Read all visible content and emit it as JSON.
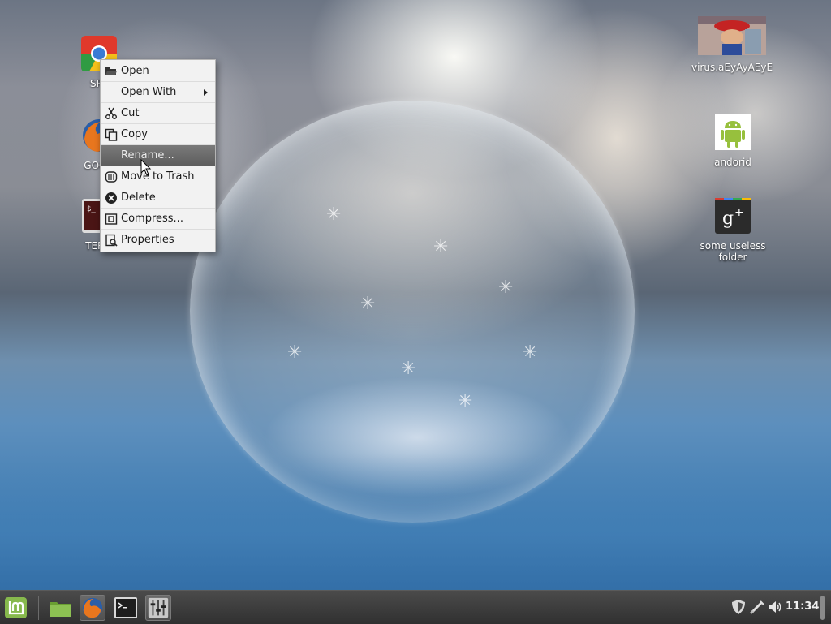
{
  "desktop": {
    "icons": [
      {
        "label": "SPY",
        "icon": "chrome-icon"
      },
      {
        "label": "GOOD",
        "icon": "firefox-icon"
      },
      {
        "label": "TERM",
        "icon": "terminal-icon"
      },
      {
        "label": "virus.aEyAyAEyE",
        "icon": "image-thumbnail-icon"
      },
      {
        "label": "andorid",
        "icon": "android-icon"
      },
      {
        "label": "some useless folder",
        "icon": "google-plus-icon"
      }
    ]
  },
  "context_menu": {
    "items": [
      {
        "label": "Open",
        "icon": "folder-open-icon",
        "highlighted": false
      },
      {
        "label": "Open With",
        "icon": "",
        "submenu": true,
        "highlighted": false
      },
      {
        "label": "Cut",
        "icon": "scissors-icon",
        "highlighted": false
      },
      {
        "label": "Copy",
        "icon": "copy-icon",
        "highlighted": false
      },
      {
        "label": "Rename...",
        "icon": "",
        "highlighted": true
      },
      {
        "label": "Move to Trash",
        "icon": "trash-icon",
        "highlighted": false
      },
      {
        "label": "Delete",
        "icon": "delete-icon",
        "highlighted": false
      },
      {
        "label": "Compress...",
        "icon": "compress-icon",
        "highlighted": false
      },
      {
        "label": "Properties",
        "icon": "properties-icon",
        "highlighted": false
      }
    ]
  },
  "panel": {
    "launchers": [
      "mint-menu-icon",
      "files-icon",
      "firefox-icon",
      "terminal-icon",
      "mixer-icon"
    ],
    "tray": [
      "shield-icon",
      "network-icon",
      "volume-icon"
    ],
    "clock": "11:34"
  },
  "colors": {
    "panel_bg": "#3a3a3a",
    "menu_bg": "#f2f2f2",
    "menu_highlight": "#666666",
    "mint_green": "#87b94d"
  }
}
